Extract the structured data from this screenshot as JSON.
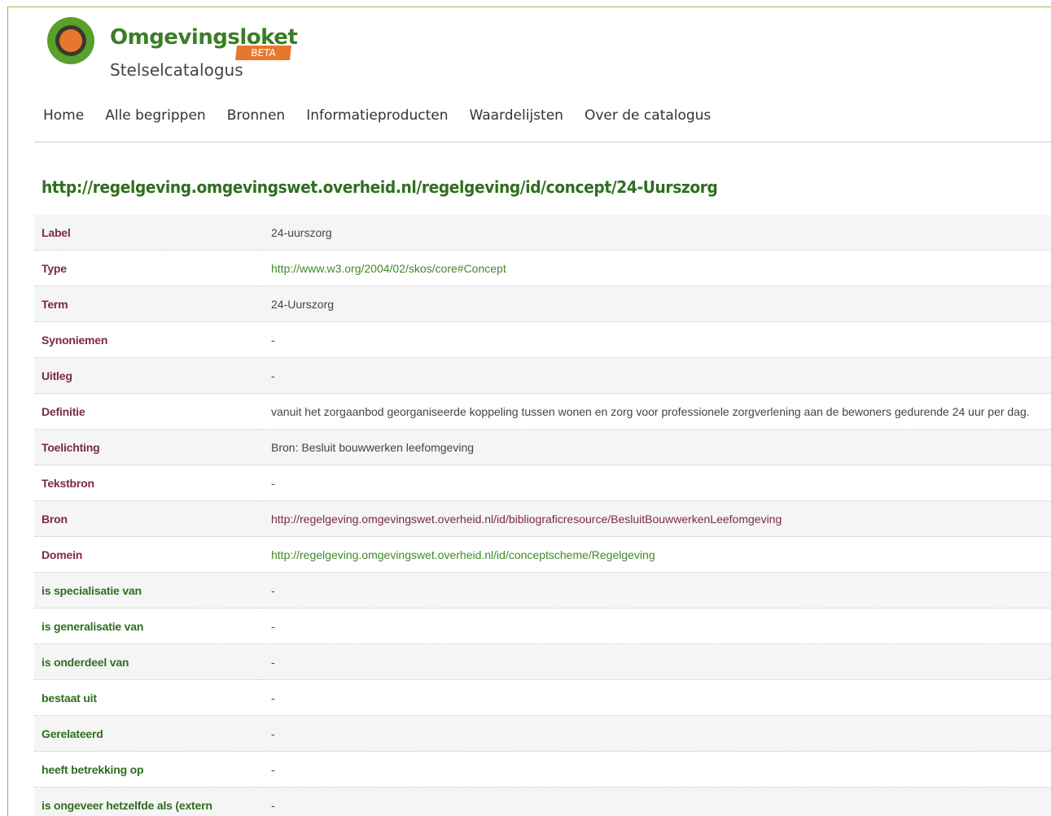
{
  "header": {
    "partial_glyph": "g",
    "brand_name": "Omgevingsloket",
    "beta": "BETA",
    "subtitle": "Stelselcatalogus"
  },
  "nav": {
    "items": [
      "Home",
      "Alle begrippen",
      "Bronnen",
      "Informatieproducten",
      "Waardelijsten",
      "Over de catalogus"
    ]
  },
  "page": {
    "title": "http://regelgeving.omgevingswet.overheid.nl/regelgeving/id/concept/24-Uurszorg"
  },
  "colors": {
    "brand_green": "#3a7e25",
    "title_green": "#2f6e1f",
    "maroon": "#7b2a45",
    "beta_orange": "#e8772e"
  },
  "properties": [
    {
      "key": "Label",
      "value": "24-uurszorg",
      "key_color": "maroon"
    },
    {
      "key": "Type",
      "value": "http://www.w3.org/2004/02/skos/core#Concept",
      "key_color": "maroon",
      "link": "green"
    },
    {
      "key": "Term",
      "value": "24-Uurszorg",
      "key_color": "maroon"
    },
    {
      "key": "Synoniemen",
      "value": "-",
      "key_color": "maroon"
    },
    {
      "key": "Uitleg",
      "value": "-",
      "key_color": "maroon"
    },
    {
      "key": "Definitie",
      "value": "vanuit het zorgaanbod georganiseerde koppeling tussen wonen en zorg voor professionele zorgverlening aan de bewoners gedurende 24 uur per dag.",
      "key_color": "maroon"
    },
    {
      "key": "Toelichting",
      "value": "Bron: Besluit bouwwerken leefomgeving",
      "key_color": "maroon"
    },
    {
      "key": "Tekstbron",
      "value": "-",
      "key_color": "maroon"
    },
    {
      "key": "Bron",
      "value": "http://regelgeving.omgevingswet.overheid.nl/id/bibliograficresource/BesluitBouwwerkenLeefomgeving",
      "key_color": "maroon",
      "link": "maroon"
    },
    {
      "key": "Domein",
      "value": "http://regelgeving.omgevingswet.overheid.nl/id/conceptscheme/Regelgeving",
      "key_color": "maroon",
      "link": "green"
    },
    {
      "key": "is specialisatie van",
      "value": "-",
      "key_color": "green"
    },
    {
      "key": "is generalisatie van",
      "value": "-",
      "key_color": "green"
    },
    {
      "key": "is onderdeel van",
      "value": "-",
      "key_color": "green"
    },
    {
      "key": "bestaat uit",
      "value": "-",
      "key_color": "green"
    },
    {
      "key": "Gerelateerd",
      "value": "-",
      "key_color": "green"
    },
    {
      "key": "heeft betrekking op",
      "value": "-",
      "key_color": "green"
    },
    {
      "key": "is ongeveer hetzelfde als (extern concept)",
      "value": "-",
      "key_color": "green"
    }
  ]
}
